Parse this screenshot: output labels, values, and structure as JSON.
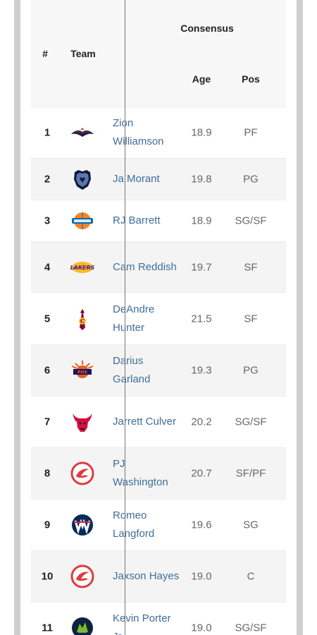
{
  "table": {
    "header": {
      "rank": "#",
      "team": "Team",
      "consensus": "Consensus",
      "age": "Age",
      "pos": "Pos"
    },
    "rows": [
      {
        "rank": "1",
        "team_logo": "pelicans-logo",
        "name": "Zion Williamson",
        "age": "18.9",
        "pos": "PF"
      },
      {
        "rank": "2",
        "team_logo": "grizzlies-logo",
        "name": "Ja Morant",
        "age": "19.8",
        "pos": "PG"
      },
      {
        "rank": "3",
        "team_logo": "knicks-logo",
        "name": "RJ Barrett",
        "age": "18.9",
        "pos": "SG/SF"
      },
      {
        "rank": "4",
        "team_logo": "lakers-logo",
        "name": "Cam Reddish",
        "age": "19.7",
        "pos": "SF"
      },
      {
        "rank": "5",
        "team_logo": "cavaliers-logo",
        "name": "DeAndre Hunter",
        "age": "21.5",
        "pos": "SF"
      },
      {
        "rank": "6",
        "team_logo": "suns-logo",
        "name": "Darius Garland",
        "age": "19.3",
        "pos": "PG"
      },
      {
        "rank": "7",
        "team_logo": "bulls-logo",
        "name": "Jarrett Culver",
        "age": "20.2",
        "pos": "SG/SF"
      },
      {
        "rank": "8",
        "team_logo": "hawks-logo",
        "name": "PJ Washington",
        "age": "20.7",
        "pos": "SF/PF"
      },
      {
        "rank": "9",
        "team_logo": "wizards-logo",
        "name": "Romeo Langford",
        "age": "19.6",
        "pos": "SG"
      },
      {
        "rank": "10",
        "team_logo": "hawks-logo",
        "name": "Jaxson Hayes",
        "age": "19.0",
        "pos": "C"
      },
      {
        "rank": "11",
        "team_logo": "timberwolves-logo",
        "name": "Kevin Porter Jr.",
        "age": "19.0",
        "pos": "SG/SF"
      }
    ]
  },
  "colors": {
    "link": "#3e6e9a",
    "row_alt": "#f4f4f4",
    "header_bg": "#f7f7f7",
    "hawks_red": "#e03a3e",
    "bulls_red": "#ce1141",
    "knicks_orange": "#f58426",
    "knicks_blue": "#006bb6",
    "lakers_purple": "#552583",
    "lakers_gold": "#fdb927",
    "cavs_wine": "#860038",
    "cavs_gold": "#fdbb30",
    "suns_purple": "#1d1160",
    "suns_orange": "#e56020",
    "grizzlies_navy": "#12173f",
    "grizzlies_blue": "#5d76a9",
    "wizards_navy": "#002b5c",
    "pelicans_navy": "#0c2340",
    "wolves_navy": "#0c2340",
    "wolves_green": "#78be20"
  }
}
